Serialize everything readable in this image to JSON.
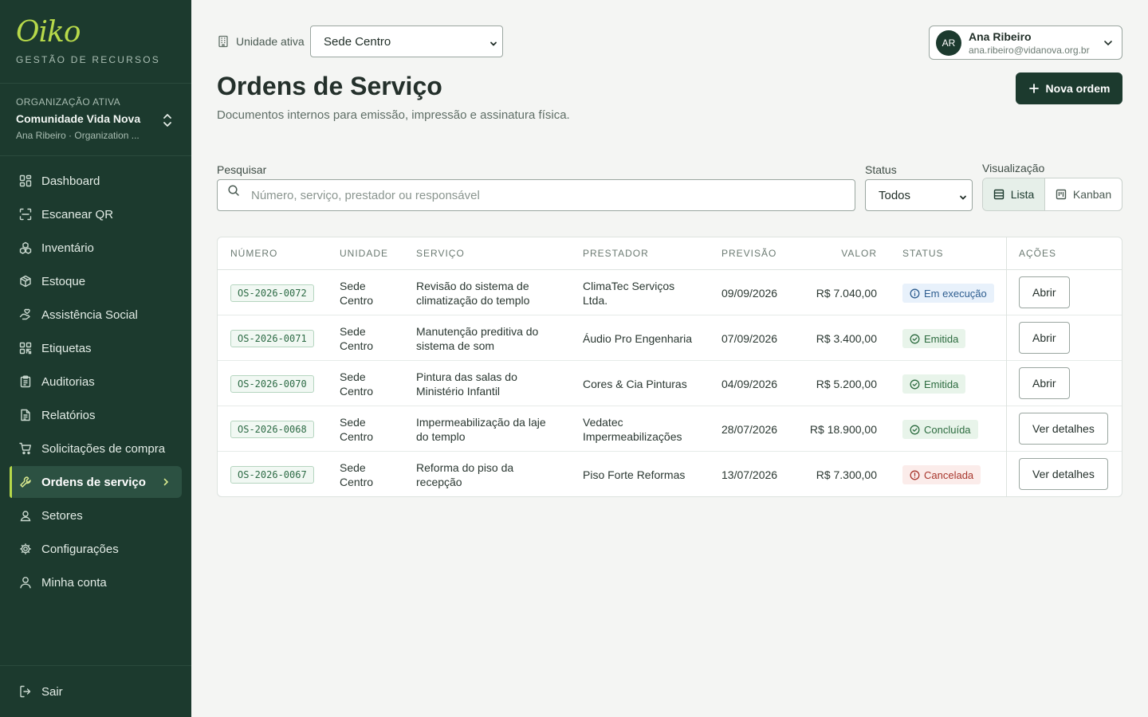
{
  "brand": {
    "logo": "Oiko",
    "subtitle": "GESTÃO DE RECURSOS"
  },
  "org": {
    "eyebrow": "ORGANIZAÇÃO ATIVA",
    "name": "Comunidade Vida Nova",
    "user_line": "Ana Ribeiro · Organization ..."
  },
  "nav": [
    {
      "label": "Dashboard",
      "icon": "dashboard-icon"
    },
    {
      "label": "Escanear QR",
      "icon": "scan-qr-icon"
    },
    {
      "label": "Inventário",
      "icon": "boxes-icon"
    },
    {
      "label": "Estoque",
      "icon": "package-icon"
    },
    {
      "label": "Assistência Social",
      "icon": "hand-heart-icon"
    },
    {
      "label": "Etiquetas",
      "icon": "qr-code-icon"
    },
    {
      "label": "Auditorias",
      "icon": "clipboard-check-icon"
    },
    {
      "label": "Relatórios",
      "icon": "file-text-icon"
    },
    {
      "label": "Solicitações de compra",
      "icon": "cart-icon"
    },
    {
      "label": "Ordens de serviço",
      "icon": "wrench-icon",
      "active": true
    },
    {
      "label": "Setores",
      "icon": "contact-icon"
    },
    {
      "label": "Configurações",
      "icon": "gear-icon"
    },
    {
      "label": "Minha conta",
      "icon": "user-icon"
    }
  ],
  "logout": "Sair",
  "unit": {
    "label": "Unidade ativa",
    "selected": "Sede Centro"
  },
  "user": {
    "initials": "AR",
    "name": "Ana Ribeiro",
    "email": "ana.ribeiro@vidanova.org.br"
  },
  "page": {
    "title": "Ordens de Serviço",
    "subtitle": "Documentos internos para emissão, impressão e assinatura física.",
    "new_button": "Nova ordem"
  },
  "filters": {
    "search_label": "Pesquisar",
    "search_placeholder": "Número, serviço, prestador ou responsável",
    "status_label": "Status",
    "status_selected": "Todos",
    "view_label": "Visualização",
    "view_list": "Lista",
    "view_kanban": "Kanban"
  },
  "table": {
    "headers": {
      "numero": "NÚMERO",
      "unidade": "UNIDADE",
      "servico": "SERVIÇO",
      "prestador": "PRESTADOR",
      "previsao": "PREVISÃO",
      "valor": "VALOR",
      "status": "STATUS",
      "acoes": "AÇÕES"
    },
    "rows": [
      {
        "numero": "OS-2026-0072",
        "unidade": "Sede Centro",
        "servico": "Revisão do sistema de climatização do templo",
        "prestador": "ClimaTec Serviços Ltda.",
        "previsao": "09/09/2026",
        "valor": "R$ 7.040,00",
        "status": "Em execução",
        "status_color": "#2d5d8f",
        "action": "Abrir"
      },
      {
        "numero": "OS-2026-0071",
        "unidade": "Sede Centro",
        "servico": "Manutenção preditiva do sistema de som",
        "prestador": "Áudio Pro Engenharia",
        "previsao": "07/09/2026",
        "valor": "R$ 3.400,00",
        "status": "Emitida",
        "status_color": "#2c6b3f",
        "action": "Abrir"
      },
      {
        "numero": "OS-2026-0070",
        "unidade": "Sede Centro",
        "servico": "Pintura das salas do Ministério Infantil",
        "prestador": "Cores & Cia Pinturas",
        "previsao": "04/09/2026",
        "valor": "R$ 5.200,00",
        "status": "Emitida",
        "status_color": "#2c6b3f",
        "action": "Abrir"
      },
      {
        "numero": "OS-2026-0068",
        "unidade": "Sede Centro",
        "servico": "Impermeabilização da laje do templo",
        "prestador": "Vedatec Impermeabilizações",
        "previsao": "28/07/2026",
        "valor": "R$ 18.900,00",
        "status": "Concluída",
        "status_color": "#2c6b3f",
        "action": "Ver detalhes"
      },
      {
        "numero": "OS-2026-0067",
        "unidade": "Sede Centro",
        "servico": "Reforma do piso da recepção",
        "prestador": "Piso Forte Reformas",
        "previsao": "13/07/2026",
        "valor": "R$ 7.300,00",
        "status": "Cancelada",
        "status_color": "#a8362c",
        "action": "Ver detalhes"
      }
    ]
  },
  "colors": {
    "sidebar": "#1c3a2e",
    "accent": "#b7d94a",
    "primary_button": "#1c3a2e",
    "page_bg": "#f4f5f3"
  }
}
